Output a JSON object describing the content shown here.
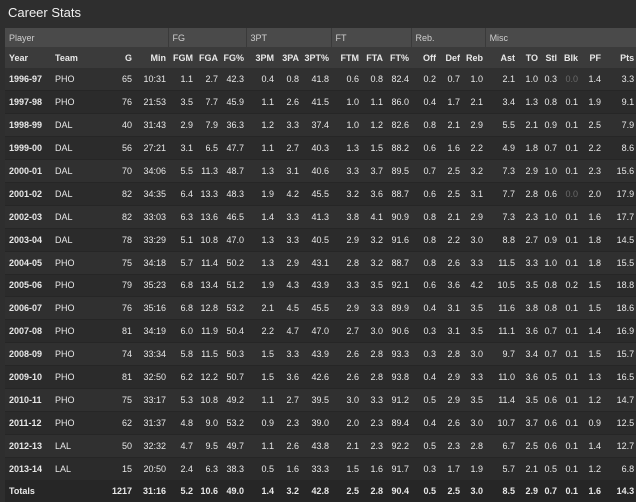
{
  "title": "Career Stats",
  "groups": [
    "Player",
    "FG",
    "3PT",
    "FT",
    "Reb.",
    "Misc"
  ],
  "columns": [
    "Year",
    "Team",
    "G",
    "Min",
    "FGM",
    "FGA",
    "FG%",
    "3PM",
    "3PA",
    "3PT%",
    "FTM",
    "FTA",
    "FT%",
    "Off",
    "Def",
    "Reb",
    "Ast",
    "TO",
    "Stl",
    "Blk",
    "PF",
    "Pts"
  ],
  "rows": [
    [
      "1996-97",
      "PHO",
      "65",
      "10:31",
      "1.1",
      "2.7",
      "42.3",
      "0.4",
      "0.8",
      "41.8",
      "0.6",
      "0.8",
      "82.4",
      "0.2",
      "0.7",
      "1.0",
      "2.1",
      "1.0",
      "0.3",
      "0.0",
      "1.4",
      "3.3"
    ],
    [
      "1997-98",
      "PHO",
      "76",
      "21:53",
      "3.5",
      "7.7",
      "45.9",
      "1.1",
      "2.6",
      "41.5",
      "1.0",
      "1.1",
      "86.0",
      "0.4",
      "1.7",
      "2.1",
      "3.4",
      "1.3",
      "0.8",
      "0.1",
      "1.9",
      "9.1"
    ],
    [
      "1998-99",
      "DAL",
      "40",
      "31:43",
      "2.9",
      "7.9",
      "36.3",
      "1.2",
      "3.3",
      "37.4",
      "1.0",
      "1.2",
      "82.6",
      "0.8",
      "2.1",
      "2.9",
      "5.5",
      "2.1",
      "0.9",
      "0.1",
      "2.5",
      "7.9"
    ],
    [
      "1999-00",
      "DAL",
      "56",
      "27:21",
      "3.1",
      "6.5",
      "47.7",
      "1.1",
      "2.7",
      "40.3",
      "1.3",
      "1.5",
      "88.2",
      "0.6",
      "1.6",
      "2.2",
      "4.9",
      "1.8",
      "0.7",
      "0.1",
      "2.2",
      "8.6"
    ],
    [
      "2000-01",
      "DAL",
      "70",
      "34:06",
      "5.5",
      "11.3",
      "48.7",
      "1.3",
      "3.1",
      "40.6",
      "3.3",
      "3.7",
      "89.5",
      "0.7",
      "2.5",
      "3.2",
      "7.3",
      "2.9",
      "1.0",
      "0.1",
      "2.3",
      "15.6"
    ],
    [
      "2001-02",
      "DAL",
      "82",
      "34:35",
      "6.4",
      "13.3",
      "48.3",
      "1.9",
      "4.2",
      "45.5",
      "3.2",
      "3.6",
      "88.7",
      "0.6",
      "2.5",
      "3.1",
      "7.7",
      "2.8",
      "0.6",
      "0.0",
      "2.0",
      "17.9"
    ],
    [
      "2002-03",
      "DAL",
      "82",
      "33:03",
      "6.3",
      "13.6",
      "46.5",
      "1.4",
      "3.3",
      "41.3",
      "3.8",
      "4.1",
      "90.9",
      "0.8",
      "2.1",
      "2.9",
      "7.3",
      "2.3",
      "1.0",
      "0.1",
      "1.6",
      "17.7"
    ],
    [
      "2003-04",
      "DAL",
      "78",
      "33:29",
      "5.1",
      "10.8",
      "47.0",
      "1.3",
      "3.3",
      "40.5",
      "2.9",
      "3.2",
      "91.6",
      "0.8",
      "2.2",
      "3.0",
      "8.8",
      "2.7",
      "0.9",
      "0.1",
      "1.8",
      "14.5"
    ],
    [
      "2004-05",
      "PHO",
      "75",
      "34:18",
      "5.7",
      "11.4",
      "50.2",
      "1.3",
      "2.9",
      "43.1",
      "2.8",
      "3.2",
      "88.7",
      "0.8",
      "2.6",
      "3.3",
      "11.5",
      "3.3",
      "1.0",
      "0.1",
      "1.8",
      "15.5"
    ],
    [
      "2005-06",
      "PHO",
      "79",
      "35:23",
      "6.8",
      "13.4",
      "51.2",
      "1.9",
      "4.3",
      "43.9",
      "3.3",
      "3.5",
      "92.1",
      "0.6",
      "3.6",
      "4.2",
      "10.5",
      "3.5",
      "0.8",
      "0.2",
      "1.5",
      "18.8"
    ],
    [
      "2006-07",
      "PHO",
      "76",
      "35:16",
      "6.8",
      "12.8",
      "53.2",
      "2.1",
      "4.5",
      "45.5",
      "2.9",
      "3.3",
      "89.9",
      "0.4",
      "3.1",
      "3.5",
      "11.6",
      "3.8",
      "0.8",
      "0.1",
      "1.5",
      "18.6"
    ],
    [
      "2007-08",
      "PHO",
      "81",
      "34:19",
      "6.0",
      "11.9",
      "50.4",
      "2.2",
      "4.7",
      "47.0",
      "2.7",
      "3.0",
      "90.6",
      "0.3",
      "3.1",
      "3.5",
      "11.1",
      "3.6",
      "0.7",
      "0.1",
      "1.4",
      "16.9"
    ],
    [
      "2008-09",
      "PHO",
      "74",
      "33:34",
      "5.8",
      "11.5",
      "50.3",
      "1.5",
      "3.3",
      "43.9",
      "2.6",
      "2.8",
      "93.3",
      "0.3",
      "2.8",
      "3.0",
      "9.7",
      "3.4",
      "0.7",
      "0.1",
      "1.5",
      "15.7"
    ],
    [
      "2009-10",
      "PHO",
      "81",
      "32:50",
      "6.2",
      "12.2",
      "50.7",
      "1.5",
      "3.6",
      "42.6",
      "2.6",
      "2.8",
      "93.8",
      "0.4",
      "2.9",
      "3.3",
      "11.0",
      "3.6",
      "0.5",
      "0.1",
      "1.3",
      "16.5"
    ],
    [
      "2010-11",
      "PHO",
      "75",
      "33:17",
      "5.3",
      "10.8",
      "49.2",
      "1.1",
      "2.7",
      "39.5",
      "3.0",
      "3.3",
      "91.2",
      "0.5",
      "2.9",
      "3.5",
      "11.4",
      "3.5",
      "0.6",
      "0.1",
      "1.2",
      "14.7"
    ],
    [
      "2011-12",
      "PHO",
      "62",
      "31:37",
      "4.8",
      "9.0",
      "53.2",
      "0.9",
      "2.3",
      "39.0",
      "2.0",
      "2.3",
      "89.4",
      "0.4",
      "2.6",
      "3.0",
      "10.7",
      "3.7",
      "0.6",
      "0.1",
      "0.9",
      "12.5"
    ],
    [
      "2012-13",
      "LAL",
      "50",
      "32:32",
      "4.7",
      "9.5",
      "49.7",
      "1.1",
      "2.6",
      "43.8",
      "2.1",
      "2.3",
      "92.2",
      "0.5",
      "2.3",
      "2.8",
      "6.7",
      "2.5",
      "0.6",
      "0.1",
      "1.4",
      "12.7"
    ],
    [
      "2013-14",
      "LAL",
      "15",
      "20:50",
      "2.4",
      "6.3",
      "38.3",
      "0.5",
      "1.6",
      "33.3",
      "1.5",
      "1.6",
      "91.7",
      "0.3",
      "1.7",
      "1.9",
      "5.7",
      "2.1",
      "0.5",
      "0.1",
      "1.2",
      "6.8"
    ]
  ],
  "totals": [
    "Totals",
    "",
    "1217",
    "31:16",
    "5.2",
    "10.6",
    "49.0",
    "1.4",
    "3.2",
    "42.8",
    "2.5",
    "2.8",
    "90.4",
    "0.5",
    "2.5",
    "3.0",
    "8.5",
    "2.9",
    "0.7",
    "0.1",
    "1.6",
    "14.3"
  ],
  "colors": {
    "background": "#2e2e2e",
    "header_group": "#4a4a4a",
    "header_cols": "#3b3b3b",
    "dim_zero": "#6a6a6a"
  }
}
